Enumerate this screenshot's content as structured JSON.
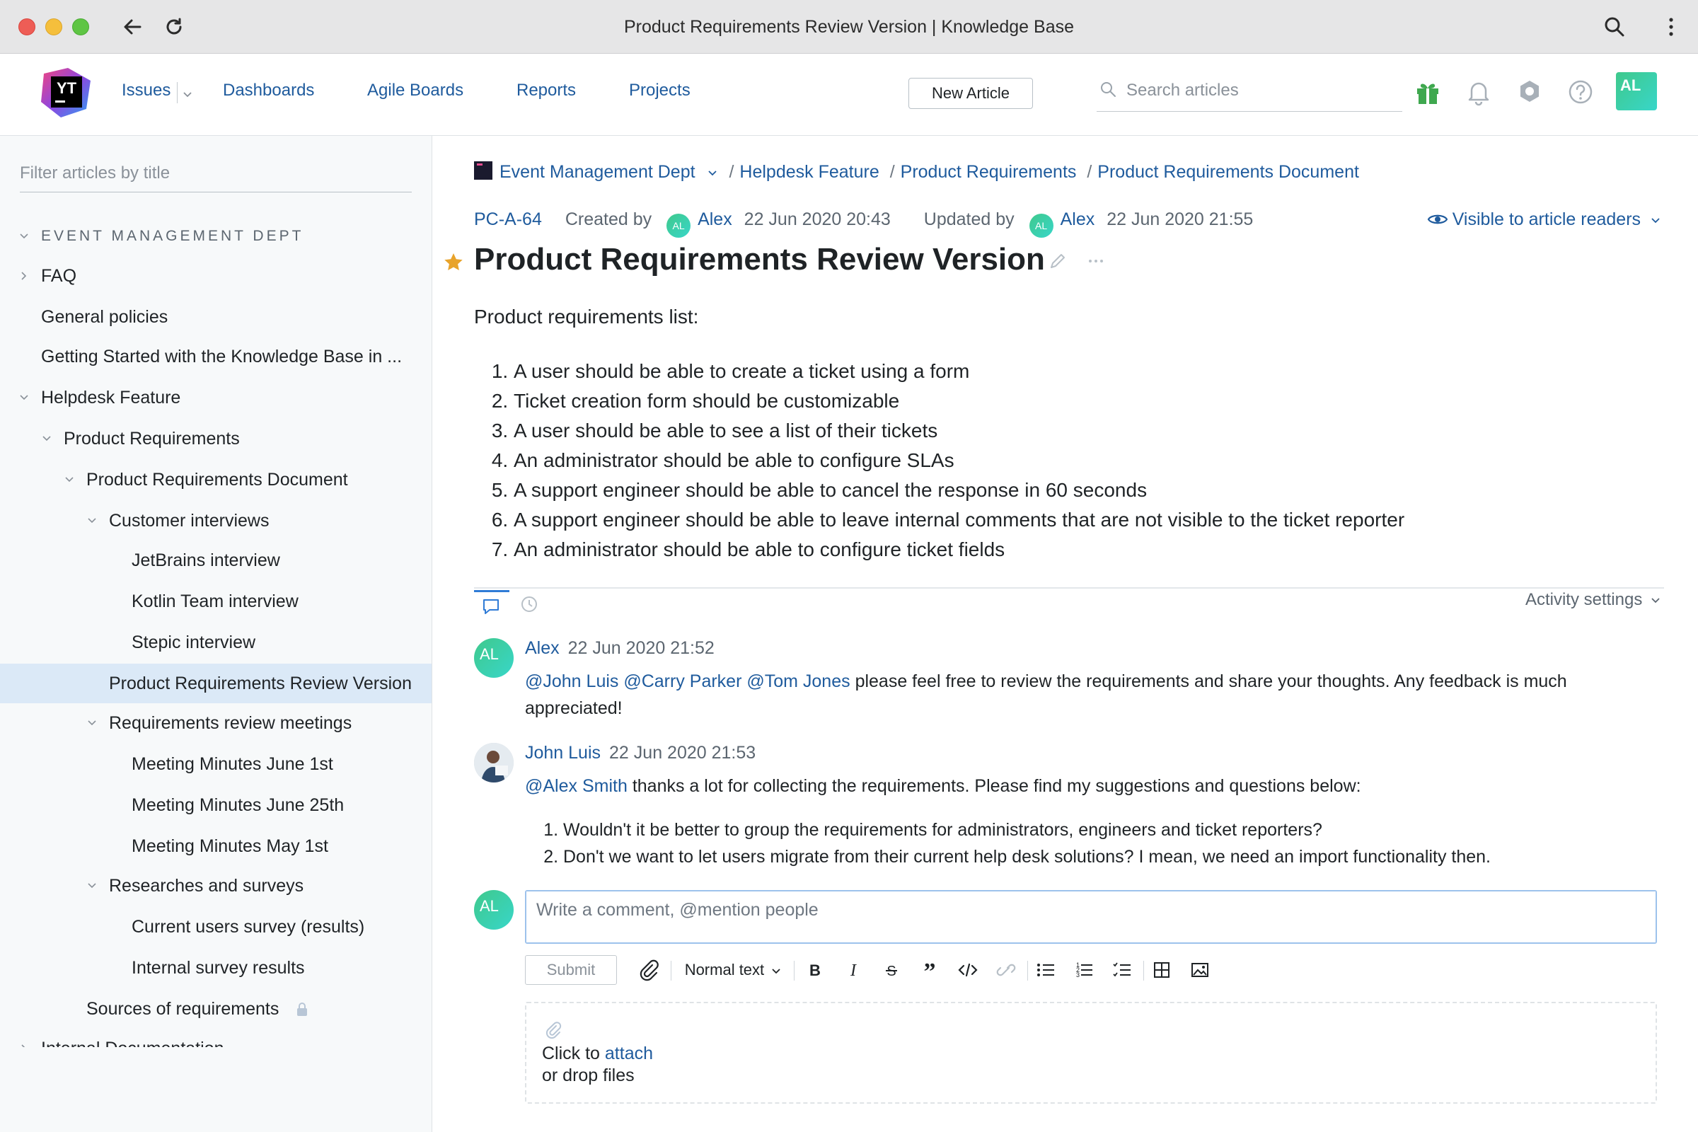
{
  "browser": {
    "title": "Product Requirements Review Version | Knowledge Base"
  },
  "header": {
    "logo_text": "YT",
    "nav": [
      "Issues",
      "Dashboards",
      "Agile Boards",
      "Reports",
      "Projects"
    ],
    "new_article_label": "New Article",
    "search_placeholder": "Search articles",
    "avatar_initials": "AL"
  },
  "sidebar": {
    "filter_placeholder": "Filter articles by title",
    "group": "EVENT MANAGEMENT DEPT",
    "items": [
      {
        "label": "FAQ"
      },
      {
        "label": "General policies"
      },
      {
        "label": "Getting Started with the Knowledge Base in ..."
      },
      {
        "label": "Helpdesk Feature"
      },
      {
        "label": "Product Requirements"
      },
      {
        "label": "Product Requirements Document"
      },
      {
        "label": "Customer interviews"
      },
      {
        "label": "JetBrains interview"
      },
      {
        "label": "Kotlin Team interview"
      },
      {
        "label": "Stepic interview"
      },
      {
        "label": "Product Requirements Review Version"
      },
      {
        "label": "Requirements review meetings"
      },
      {
        "label": "Meeting Minutes June 1st"
      },
      {
        "label": "Meeting Minutes June 25th"
      },
      {
        "label": "Meeting Minutes May 1st"
      },
      {
        "label": "Researches and surveys"
      },
      {
        "label": "Current users survey (results)"
      },
      {
        "label": "Internal survey results"
      },
      {
        "label": "Sources of requirements"
      },
      {
        "label": "Internal Documentation"
      }
    ]
  },
  "breadcrumb": [
    "Event Management Dept",
    "Helpdesk Feature",
    "Product Requirements",
    "Product Requirements Document"
  ],
  "article": {
    "id": "PC-A-64",
    "created_by_label": "Created by",
    "created_by": "Alex",
    "created_at": "22 Jun 2020 20:43",
    "updated_by_label": "Updated by",
    "updated_by": "Alex",
    "updated_at": "22 Jun 2020 21:55",
    "visibility": "Visible to article readers",
    "title": "Product Requirements Review Version",
    "intro": "Product requirements list:",
    "requirements": [
      "A user should be able to create a ticket using a form",
      "Ticket creation form should be customizable",
      "A user should be able to see a list of their tickets",
      "An administrator should be able to configure SLAs",
      "A support engineer should be able to cancel the response in 60 seconds",
      "A support engineer should be able to leave internal comments that are not visible to the ticket reporter",
      "An administrator should be able to configure ticket fields"
    ]
  },
  "activity": {
    "settings_label": "Activity settings",
    "comments": [
      {
        "author": "Alex",
        "avatar": "AL",
        "date": "22 Jun 2020 21:52",
        "mentions": "@John Luis @Carry Parker @Tom Jones",
        "text": " please feel free to review the requirements and share your thoughts. Any feedback is much appreciated!"
      },
      {
        "author": "John Luis",
        "date": "22 Jun 2020 21:53",
        "mentions": "@Alex Smith",
        "text": " thanks a lot for collecting the requirements. Please find my suggestions and questions below:",
        "list": [
          "Wouldn't it be better to group the requirements for administrators, engineers and ticket reporters?",
          "Don't we want to let users migrate from their current help desk solutions? I mean, we need an import functionality then."
        ]
      }
    ]
  },
  "composer": {
    "avatar": "AL",
    "placeholder": "Write a comment, @mention people",
    "submit_label": "Submit",
    "text_style": "Normal text",
    "drop_text_1": "Click to ",
    "drop_link": "attach",
    "drop_text_2": "or drop files"
  },
  "colors": {
    "link": "#1f5b9d",
    "selected_row": "#dbe9f7",
    "avatar_gradient_start": "#3fc98c",
    "star": "#e8a32b"
  }
}
